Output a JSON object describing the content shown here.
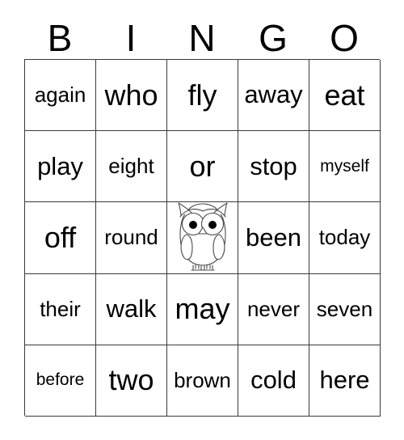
{
  "card": {
    "title": "BINGO",
    "header_letters": [
      "B",
      "I",
      "N",
      "G",
      "O"
    ],
    "grid": {
      "columns": 5,
      "rows": 5,
      "cells": [
        [
          {
            "text": "again",
            "type": "word"
          },
          {
            "text": "who",
            "type": "word"
          },
          {
            "text": "fly",
            "type": "word"
          },
          {
            "text": "away",
            "type": "word"
          },
          {
            "text": "eat",
            "type": "word"
          }
        ],
        [
          {
            "text": "play",
            "type": "word"
          },
          {
            "text": "eight",
            "type": "word"
          },
          {
            "text": "or",
            "type": "word"
          },
          {
            "text": "stop",
            "type": "word"
          },
          {
            "text": "myself",
            "type": "word"
          }
        ],
        [
          {
            "text": "off",
            "type": "word"
          },
          {
            "text": "round",
            "type": "word"
          },
          {
            "text": "",
            "type": "image",
            "icon": "owl-icon"
          },
          {
            "text": "been",
            "type": "word"
          },
          {
            "text": "today",
            "type": "word"
          }
        ],
        [
          {
            "text": "their",
            "type": "word"
          },
          {
            "text": "walk",
            "type": "word"
          },
          {
            "text": "may",
            "type": "word"
          },
          {
            "text": "never",
            "type": "word"
          },
          {
            "text": "seven",
            "type": "word"
          }
        ],
        [
          {
            "text": "before",
            "type": "word"
          },
          {
            "text": "two",
            "type": "word"
          },
          {
            "text": "brown",
            "type": "word"
          },
          {
            "text": "cold",
            "type": "word"
          },
          {
            "text": "here",
            "type": "word"
          }
        ]
      ]
    },
    "colors": {
      "background": "#ffffff",
      "text": "#000000",
      "grid_line": "#3a3a3a",
      "owl_outline": "#4a4a4a",
      "owl_pupil": "#000000"
    }
  }
}
